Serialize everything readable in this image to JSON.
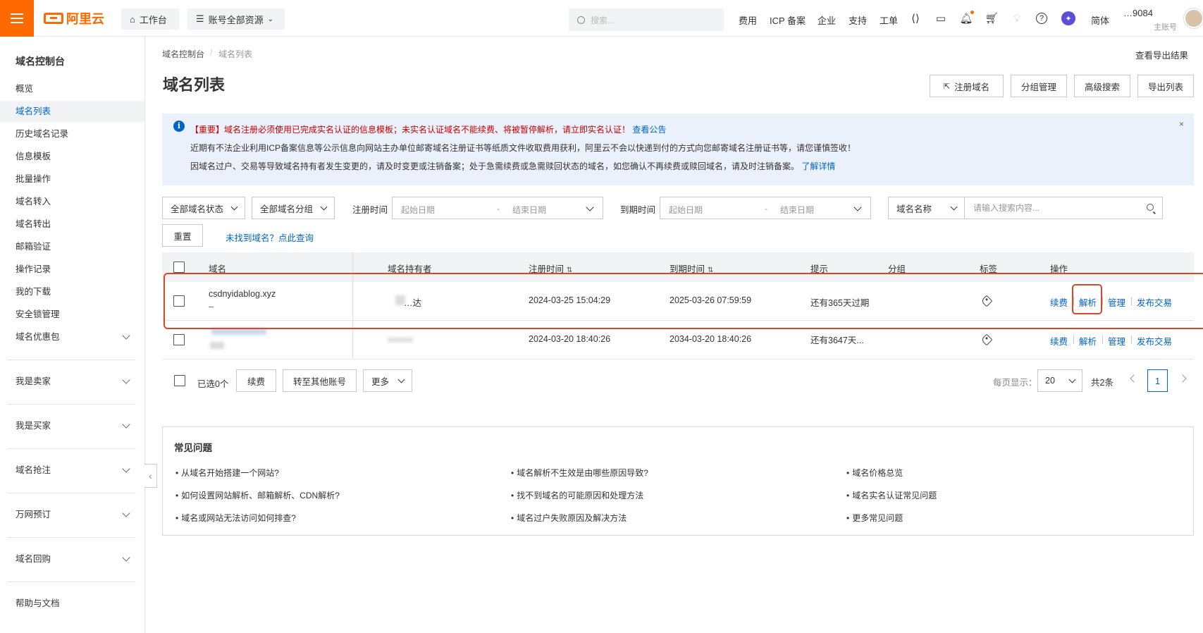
{
  "topbar": {
    "logo_text": "阿里云",
    "workbench": "工作台",
    "resources": "账号全部资源",
    "search_placeholder": "搜索...",
    "links": [
      "费用",
      "ICP 备案",
      "企业",
      "支持",
      "工单"
    ],
    "lang": "简体",
    "user_id": "…9084",
    "user_role": "主账号",
    "icons": [
      "menu-icon",
      "home-icon",
      "list-icon",
      "search-icon",
      "code-icon",
      "terminal-icon",
      "bell-icon",
      "cart-icon",
      "bulb-icon",
      "help-icon",
      "planet-icon"
    ]
  },
  "sidebar": {
    "title": "域名控制台",
    "items": [
      "概览",
      "域名列表",
      "历史域名记录",
      "信息模板",
      "批量操作",
      "域名转入",
      "域名转出",
      "邮箱验证",
      "操作记录",
      "我的下载",
      "安全锁管理",
      "域名优惠包"
    ],
    "active_index": 1,
    "groups": [
      "我是卖家",
      "我是买家",
      "域名抢注",
      "万网预订",
      "域名回购"
    ],
    "help": "帮助与文档"
  },
  "breadcrumb": [
    "域名控制台",
    "域名列表"
  ],
  "page_title": "域名列表",
  "export_result": "查看导出结果",
  "header_buttons": [
    "注册域名",
    "分组管理",
    "高级搜索",
    "导出列表"
  ],
  "notice": {
    "line1": "【重要】域名注册必须使用已完成实名认证的信息模板；未实名认证域名不能续费、将被暂停解析，请立即实名认证！",
    "line1_link": "查看公告",
    "line2": "近期有不法企业利用ICP备案信息等公示信息向网站主办单位邮寄域名注册证书等纸质文件收取费用获利，阿里云不会以快递到付的方式向您邮寄域名注册证书等，请您谨慎签收！",
    "line3": "因域名过户、交易等导致域名持有者发生变更的，请及时变更或注销备案；处于急需续费或急需赎回状态的域名，如您确认不再续费或赎回域名，请及时注销备案。",
    "line3_link": "了解详情",
    "close": "×"
  },
  "filters": {
    "status": "全部域名状态",
    "group": "全部域名分组",
    "reg_time_label": "注册时间",
    "exp_time_label": "到期时间",
    "start_placeholder": "起始日期",
    "end_placeholder": "结束日期",
    "range_sep": "-",
    "search_field": "域名名称",
    "search_placeholder": "请输入搜索内容...",
    "reset": "重置",
    "not_found_link": "未找到域名？点此查询"
  },
  "table": {
    "headers": [
      "域名",
      "域名持有者",
      "注册时间",
      "到期时间",
      "提示",
      "分组",
      "标签",
      "操作"
    ],
    "rows": [
      {
        "domain": "csdnyidablog.xyz",
        "sub": "–",
        "owner": "…达",
        "reg": "2024-03-25 15:04:29",
        "exp": "2025-03-26 07:59:59",
        "hint": "还有365天过期",
        "group": ""
      },
      {
        "domain": "",
        "sub": "",
        "owner": "",
        "reg": "2024-03-20 18:40:26",
        "exp": "2034-03-20 18:40:26",
        "hint": "还有3647天...",
        "group": ""
      }
    ],
    "ops": [
      "续费",
      "解析",
      "管理",
      "发布交易"
    ]
  },
  "footer": {
    "selected": "已选0个",
    "renew": "续费",
    "transfer": "转至其他账号",
    "more": "更多",
    "per_page_label": "每页显示：",
    "per_page": "20",
    "total": "共2条",
    "page": "1"
  },
  "faq": {
    "title": "常见问题",
    "items": [
      "从域名开始搭建一个网站?",
      "域名解析不生效是由哪些原因导致?",
      "域名价格总览",
      "如何设置网站解析、邮箱解析、CDN解析?",
      "找不到域名的可能原因和处理方法",
      "域名实名认证常见问题",
      "域名或网站无法访问如何排查?",
      "域名过户失败原因及解决方法",
      "更多常见问题"
    ]
  },
  "colors": {
    "brand": "#ff6a00",
    "link": "#0064c8",
    "highlight": "#d9472b",
    "notice_bg": "#ebf1fa"
  }
}
